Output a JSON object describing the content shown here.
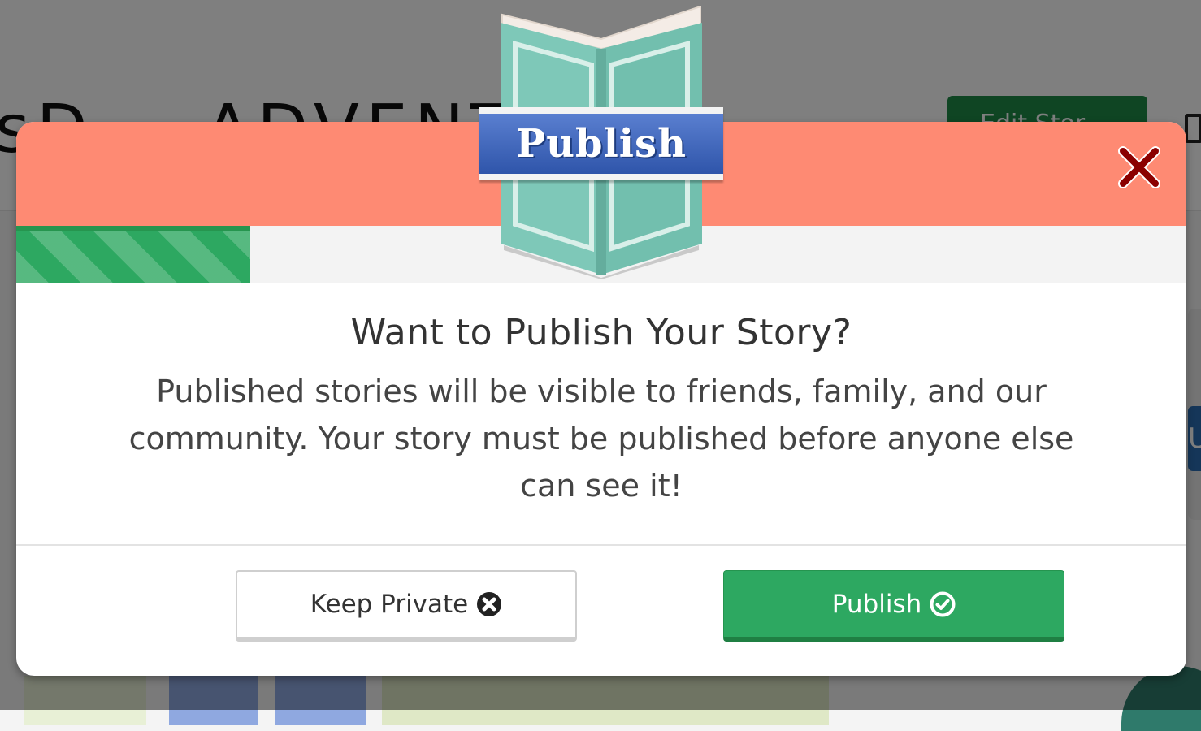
{
  "background": {
    "title": "sD... ADVENTU",
    "edit_button_label": "Edit Stor",
    "right_tab": "U"
  },
  "modal": {
    "badge_label": "Publish",
    "progress_percent": 20,
    "title": "Want to Publish Your Story?",
    "text": "Published stories will be visible to friends, family, and our community. Your story must be published before anyone else can see it!",
    "keep_private_label": "Keep Private",
    "publish_label": "Publish"
  },
  "colors": {
    "header": "#fe8a73",
    "progress": "#2da861",
    "publish_button": "#2da861",
    "close_icon": "#8b0000",
    "badge_banner": "#3a62b8",
    "book": "#7ec8b8"
  },
  "icons": {
    "close": "close-icon",
    "keep_private": "x-circle-icon",
    "publish": "check-circle-icon",
    "badge": "open-book-icon"
  }
}
